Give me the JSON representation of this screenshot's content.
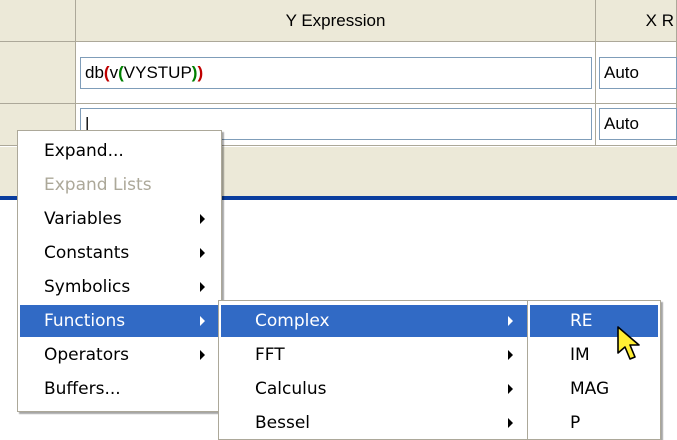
{
  "table": {
    "columns": [
      {
        "label": "Y Expression"
      },
      {
        "label": "X R"
      }
    ],
    "rows": [
      {
        "expr_prefix": "db",
        "expr_paren1": "(",
        "expr_func": "v",
        "expr_paren2": "(",
        "expr_arg": "VYSTUP",
        "expr_close2": ")",
        "expr_close1": ")",
        "x_range": "Auto"
      },
      {
        "expr": "|",
        "x_range": "Auto"
      }
    ]
  },
  "context_menu": {
    "items": [
      {
        "label": "Expand...",
        "disabled": false,
        "submenu": false
      },
      {
        "label": "Expand Lists",
        "disabled": true,
        "submenu": false
      },
      {
        "label": "Variables",
        "disabled": false,
        "submenu": true
      },
      {
        "label": "Constants",
        "disabled": false,
        "submenu": true
      },
      {
        "label": "Symbolics",
        "disabled": false,
        "submenu": true
      },
      {
        "label": "Functions",
        "disabled": false,
        "submenu": true,
        "selected": true
      },
      {
        "label": "Operators",
        "disabled": false,
        "submenu": true
      },
      {
        "label": "Buffers...",
        "disabled": false,
        "submenu": false
      }
    ]
  },
  "functions_submenu": {
    "items": [
      {
        "label": "Complex",
        "submenu": true,
        "selected": true
      },
      {
        "label": "FFT",
        "submenu": true
      },
      {
        "label": "Calculus",
        "submenu": true
      },
      {
        "label": "Bessel",
        "submenu": true
      }
    ]
  },
  "complex_submenu": {
    "items": [
      {
        "label": "RE",
        "selected": true
      },
      {
        "label": "IM"
      },
      {
        "label": "MAG"
      },
      {
        "label": "P"
      }
    ]
  },
  "colors": {
    "selection": "#316ac5",
    "paren_red": "#c00000",
    "paren_green": "#008000",
    "header_bg": "#ece9d8",
    "band_blue": "#0a3d9e"
  }
}
